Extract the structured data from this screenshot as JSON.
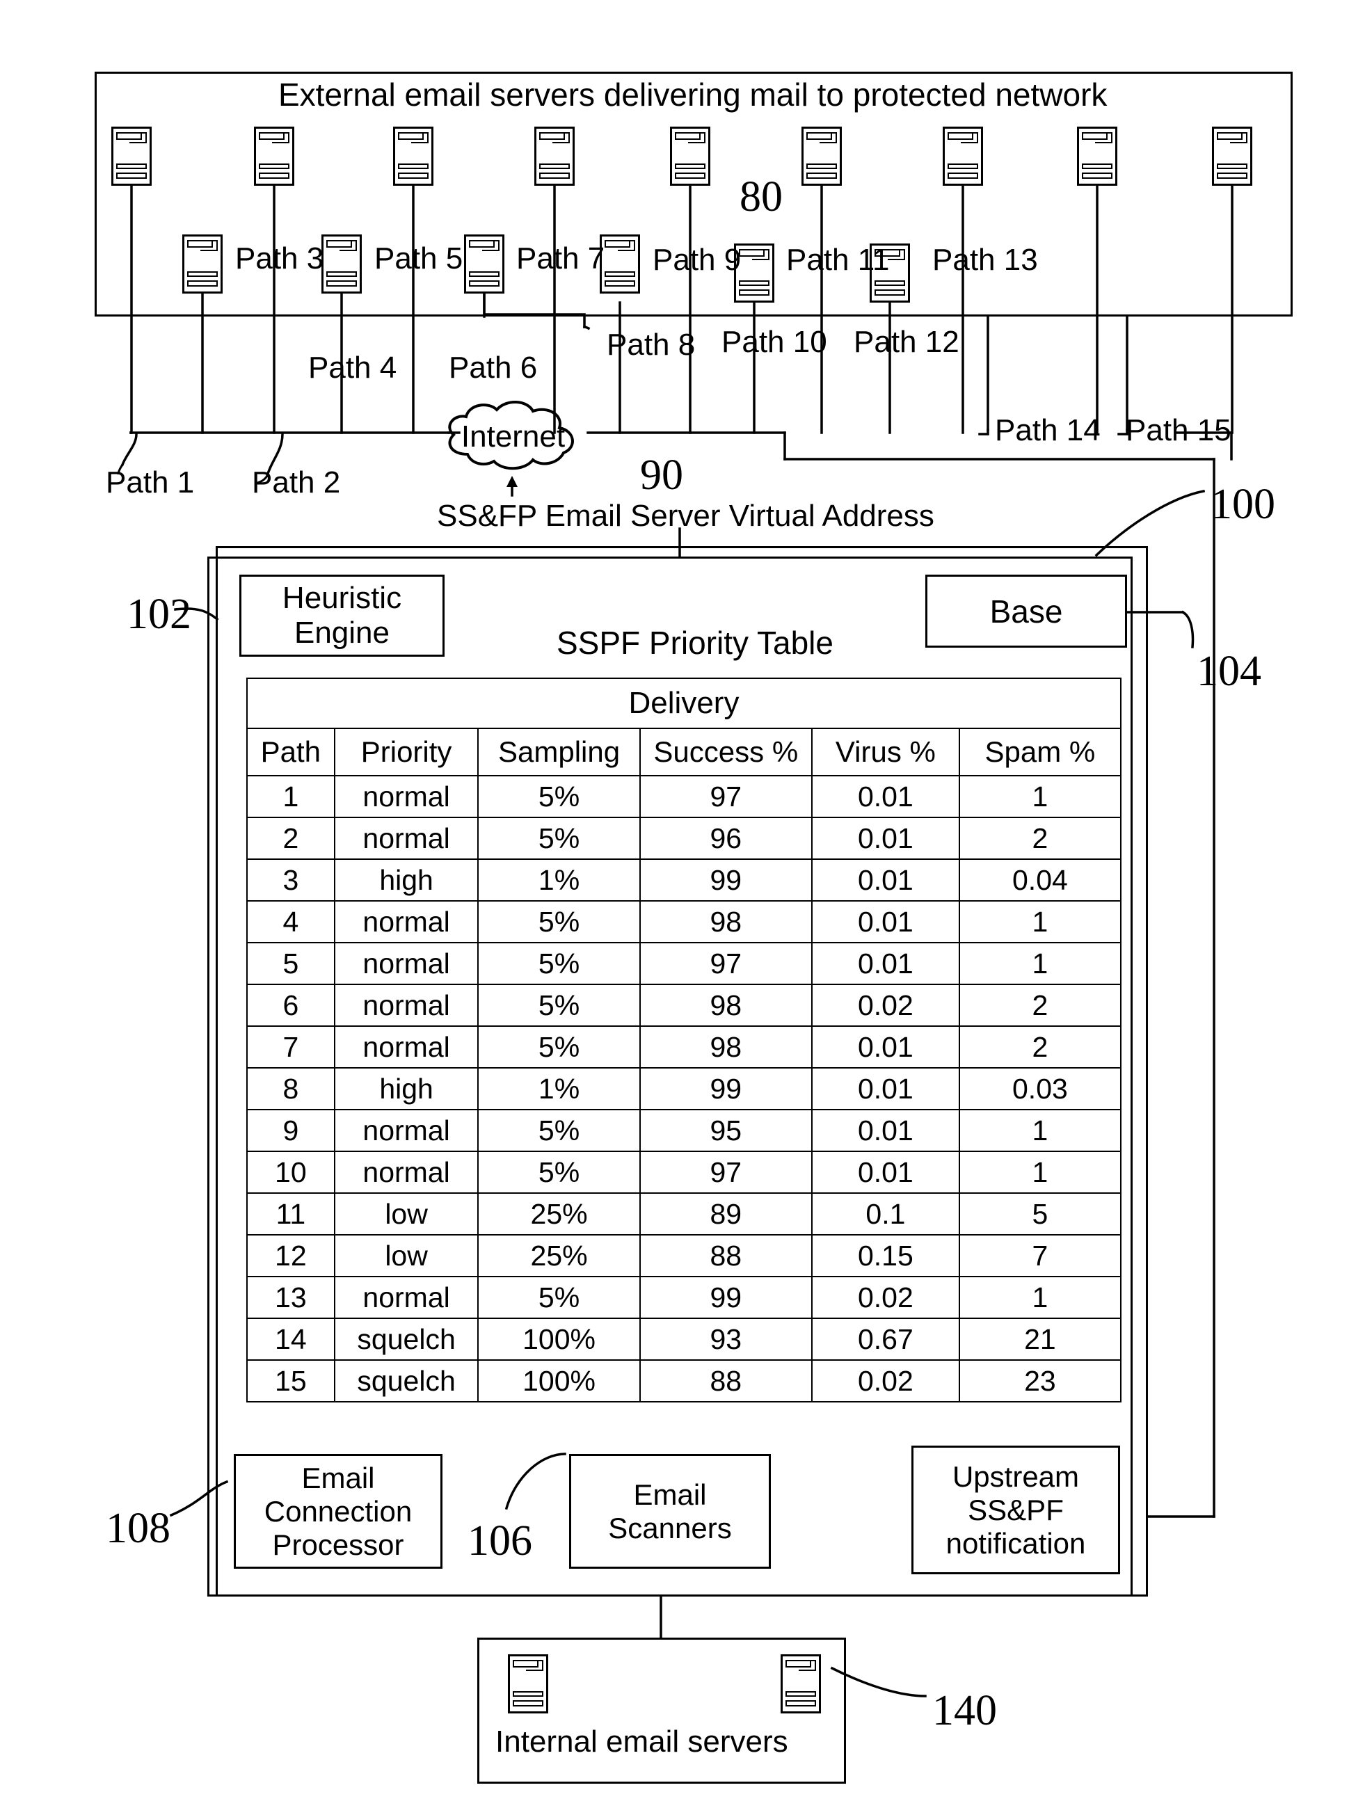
{
  "figure": {
    "external_panel_title": "External email servers delivering mail to protected network",
    "internet_label": "Internet",
    "virtual_address_label": "SS&FP Email Server Virtual Address",
    "internal_servers_label": "Internal email servers"
  },
  "reference_numerals": {
    "external_servers": "80",
    "internet": "90",
    "sspf_appliance": "100",
    "heuristic_engine": "102",
    "base": "104",
    "email_scanners": "106",
    "email_connection_processor": "108",
    "internal_email_servers": "140"
  },
  "path_labels": {
    "upper_row": [
      "Path 3",
      "Path 5",
      "Path 7",
      "Path 9",
      "Path 11",
      "Path 13"
    ],
    "mid_row": [
      "Path 8",
      "Path 10",
      "Path 12"
    ],
    "lower_row": [
      "Path 4",
      "Path 6"
    ],
    "right_row": [
      "Path 14",
      "Path 15"
    ],
    "bottom_left": [
      "Path 1",
      "Path 2"
    ]
  },
  "blocks": {
    "heuristic_engine": "Heuristic\nEngine",
    "heuristic_engine_line1": "Heuristic",
    "heuristic_engine_line2": "Engine",
    "base": "Base",
    "table_title": "SSPF Priority Table",
    "email_connection_processor_l1": "Email",
    "email_connection_processor_l2": "Connection",
    "email_connection_processor_l3": "Processor",
    "email_scanners_l1": "Email",
    "email_scanners_l2": "Scanners",
    "upstream_l1": "Upstream",
    "upstream_l2": "SS&PF",
    "upstream_l3": "notification"
  },
  "chart_data": {
    "type": "table",
    "title": "SSPF Priority Table",
    "group_header": "Delivery",
    "columns": [
      "Path",
      "Priority",
      "Sampling",
      "Success %",
      "Virus %",
      "Spam %"
    ],
    "rows": [
      [
        "1",
        "normal",
        "5%",
        "97",
        "0.01",
        "1"
      ],
      [
        "2",
        "normal",
        "5%",
        "96",
        "0.01",
        "2"
      ],
      [
        "3",
        "high",
        "1%",
        "99",
        "0.01",
        "0.04"
      ],
      [
        "4",
        "normal",
        "5%",
        "98",
        "0.01",
        "1"
      ],
      [
        "5",
        "normal",
        "5%",
        "97",
        "0.01",
        "1"
      ],
      [
        "6",
        "normal",
        "5%",
        "98",
        "0.02",
        "2"
      ],
      [
        "7",
        "normal",
        "5%",
        "98",
        "0.01",
        "2"
      ],
      [
        "8",
        "high",
        "1%",
        "99",
        "0.01",
        "0.03"
      ],
      [
        "9",
        "normal",
        "5%",
        "95",
        "0.01",
        "1"
      ],
      [
        "10",
        "normal",
        "5%",
        "97",
        "0.01",
        "1"
      ],
      [
        "11",
        "low",
        "25%",
        "89",
        "0.1",
        "5"
      ],
      [
        "12",
        "low",
        "25%",
        "88",
        "0.15",
        "7"
      ],
      [
        "13",
        "normal",
        "5%",
        "99",
        "0.02",
        "1"
      ],
      [
        "14",
        "squelch",
        "100%",
        "93",
        "0.67",
        "21"
      ],
      [
        "15",
        "squelch",
        "100%",
        "88",
        "0.02",
        "23"
      ]
    ]
  }
}
